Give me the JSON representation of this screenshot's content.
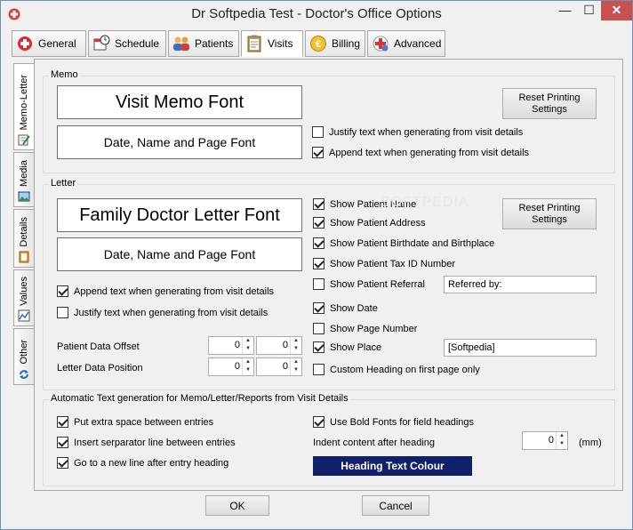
{
  "window": {
    "title": "Dr Softpedia Test - Doctor's Office Options",
    "min_glyph": "—",
    "max_glyph": "☐",
    "close_glyph": "✕"
  },
  "toolbar": {
    "tabs": [
      {
        "label": "General",
        "icon": "plus-cross-icon"
      },
      {
        "label": "Schedule",
        "icon": "calendar-clock-icon"
      },
      {
        "label": "Patients",
        "icon": "people-icon"
      },
      {
        "label": "Visits",
        "icon": "clipboard-icon"
      },
      {
        "label": "Billing",
        "icon": "euro-coin-icon"
      },
      {
        "label": "Advanced",
        "icon": "medical-kit-icon"
      }
    ]
  },
  "side_tabs": [
    {
      "label": "Memo-Letter",
      "icon": "notepad-pencil-icon"
    },
    {
      "label": "Media",
      "icon": "picture-icon"
    },
    {
      "label": "Details",
      "icon": "clipboard-small-icon"
    },
    {
      "label": "Values",
      "icon": "chart-icon"
    },
    {
      "label": "Other",
      "icon": "refresh-icon"
    }
  ],
  "memo": {
    "group_label": "Memo",
    "font_box": "Visit Memo Font",
    "date_box": "Date, Name and Page Font",
    "reset_button": "Reset Printing Settings",
    "justify_label": "Justify text when generating from visit details",
    "justify_checked": false,
    "append_label": "Append text when generating from visit details",
    "append_checked": true
  },
  "letter": {
    "group_label": "Letter",
    "font_box": "Family Doctor Letter Font",
    "date_box": "Date, Name and Page Font",
    "reset_button": "Reset Printing Settings",
    "append_label": "Append text when generating from visit details",
    "justify_label": "Justify text when generating from visit details",
    "patient_offset_label": "Patient Data Offset",
    "letter_position_label": "Letter Data Position",
    "offset_x": "0",
    "offset_y": "0",
    "position_x": "0",
    "position_y": "0",
    "show_name": "Show Patient Name",
    "show_address": "Show Patient Address",
    "show_birth": "Show Patient Birthdate and Birthplace",
    "show_tax": "Show Patient Tax ID Number",
    "show_referral": "Show Patient Referral",
    "referral_value": "Referred by:",
    "show_date": "Show Date",
    "show_page": "Show Page Number",
    "show_place": "Show Place",
    "place_value": "[Softpedia]",
    "custom_heading": "Custom Heading on first page only"
  },
  "auto": {
    "group_label": "Automatic Text generation for Memo/Letter/Reports from Visit Details",
    "extra_space": "Put extra space between entries",
    "separator": "Insert serparator line between entries",
    "new_line": "Go to a new line after entry heading",
    "bold_fonts": "Use Bold Fonts for field headings",
    "indent_label": "Indent content after heading",
    "indent_value": "0",
    "indent_unit": "(mm)",
    "heading_color_button": "Heading Text Colour"
  },
  "footer": {
    "ok": "OK",
    "cancel": "Cancel"
  },
  "watermark": "SOFTPEDIA",
  "colors": {
    "accent_close": "#c75050",
    "heading_color": "#10206b"
  }
}
